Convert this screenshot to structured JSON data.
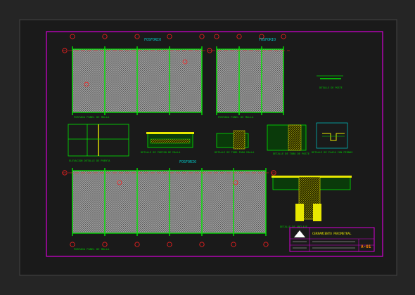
{
  "colors": {
    "viewport": "#252525",
    "sheet": "#1a1a1a",
    "sheet_border": "#444444",
    "frame": "#d400d4",
    "grid": "#c8c8c8",
    "column": "#00e600",
    "axis": "#ff2020",
    "label": "#00cc00",
    "text": "#e8e800",
    "accent": "#00cccc"
  },
  "labels": {
    "section_a": "FOSFORIO",
    "section_b": "FOSFORIO",
    "section_c": "FOSFORIO",
    "panel_a_caption": "PORTADA PANEL DE MALLA",
    "panel_b_caption": "PORTADA PANEL DE MALLA",
    "panel_c_caption": "PORTADA PANEL DE MALLA",
    "detail_1_caption": "ELEVACION DETALLE DE PUERTA",
    "detail_2_caption": "DETALLE DE PORTON DE MALLA",
    "detail_3_caption": "DETALLE DE TUBO PARA MALLA",
    "detail_4_caption": "DETALLE DE TUBO DE POSTE",
    "detail_5_caption": "DETALLE DE PLACA CON PERNOS",
    "detail_6_caption": "DETALLE DE ANCLAJE",
    "corner_note": "DETALLE DE POSTE",
    "title_block_name": "CERRAMIENTO PERIMETRAL",
    "title_block_sheet": "A-01"
  }
}
